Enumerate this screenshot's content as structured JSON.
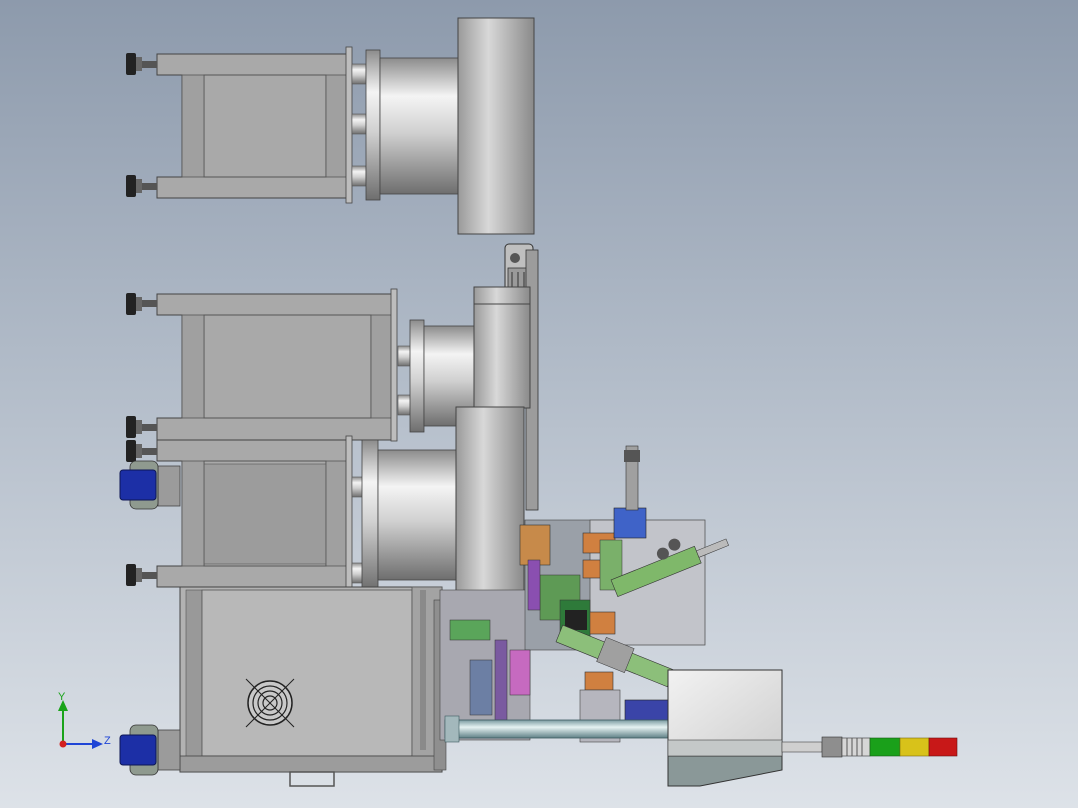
{
  "view": {
    "type": "cad-assembly-drawing",
    "background_top": "#8d9aac",
    "background_bottom": "#dde2e8"
  },
  "triad": {
    "axes": [
      {
        "label": "Y",
        "color": "#1aa31a"
      },
      {
        "label": "Z",
        "color": "#1f45d6"
      },
      {
        "label": "X",
        "color": "#d42020"
      }
    ]
  },
  "colors": {
    "steel": "#a9a9a9",
    "drum": "#c8c8c8",
    "caster": "#1c2fa6",
    "light_green": "#1aa01a",
    "light_yellow": "#d8c21a",
    "light_red": "#c81818"
  },
  "parts": [
    {
      "name": "vibratory-feeder-bowl",
      "count": 3
    },
    {
      "name": "bowl-support-frame",
      "count": 3
    },
    {
      "name": "leveling-foot",
      "count": 6
    },
    {
      "name": "caster-wheel",
      "count": 2
    },
    {
      "name": "electrical-cabinet",
      "count": 1
    },
    {
      "name": "cooling-fan",
      "count": 1
    },
    {
      "name": "signal-tower-light",
      "count": 1
    }
  ]
}
